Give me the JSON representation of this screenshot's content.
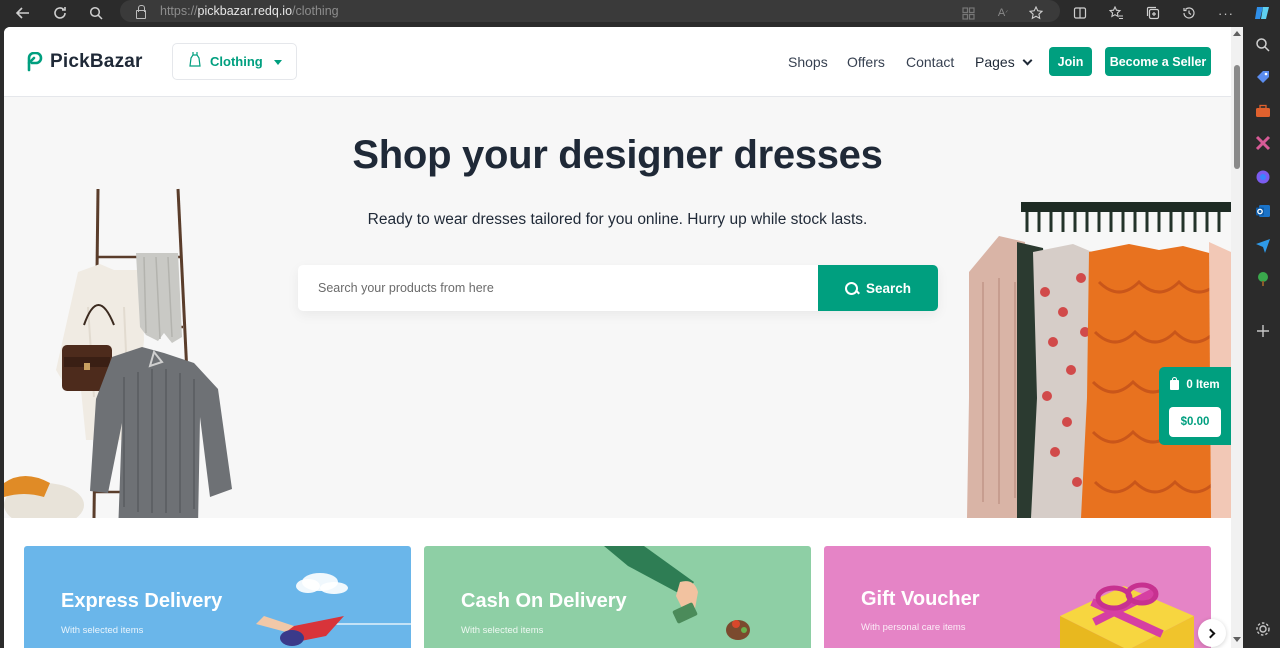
{
  "browser": {
    "url_scheme": "https://",
    "url_host": "pickbazar.redq.io",
    "url_path": "/clothing"
  },
  "header": {
    "logo_text": "PickBazar",
    "category_selected": "Clothing",
    "nav": [
      "Shops",
      "Offers",
      "Contact"
    ],
    "pages_label": "Pages",
    "join_label": "Join",
    "seller_label": "Become a Seller"
  },
  "hero": {
    "title": "Shop your designer dresses",
    "subtitle": "Ready to wear dresses tailored for you online. Hurry up while stock lasts.",
    "search_placeholder": "Search your products from here",
    "search_button": "Search"
  },
  "cart": {
    "items_label": "0 Item",
    "total": "$0.00"
  },
  "promos": [
    {
      "title": "Express Delivery",
      "subtitle": "With selected items",
      "color": "#6ab6ea"
    },
    {
      "title": "Cash On Delivery",
      "subtitle": "With selected items",
      "color": "#8ecfa5"
    },
    {
      "title": "Gift Voucher",
      "subtitle": "With personal care items",
      "color": "#e584c6"
    }
  ],
  "colors": {
    "accent": "#009f7f",
    "text_dark": "#1f2937"
  }
}
